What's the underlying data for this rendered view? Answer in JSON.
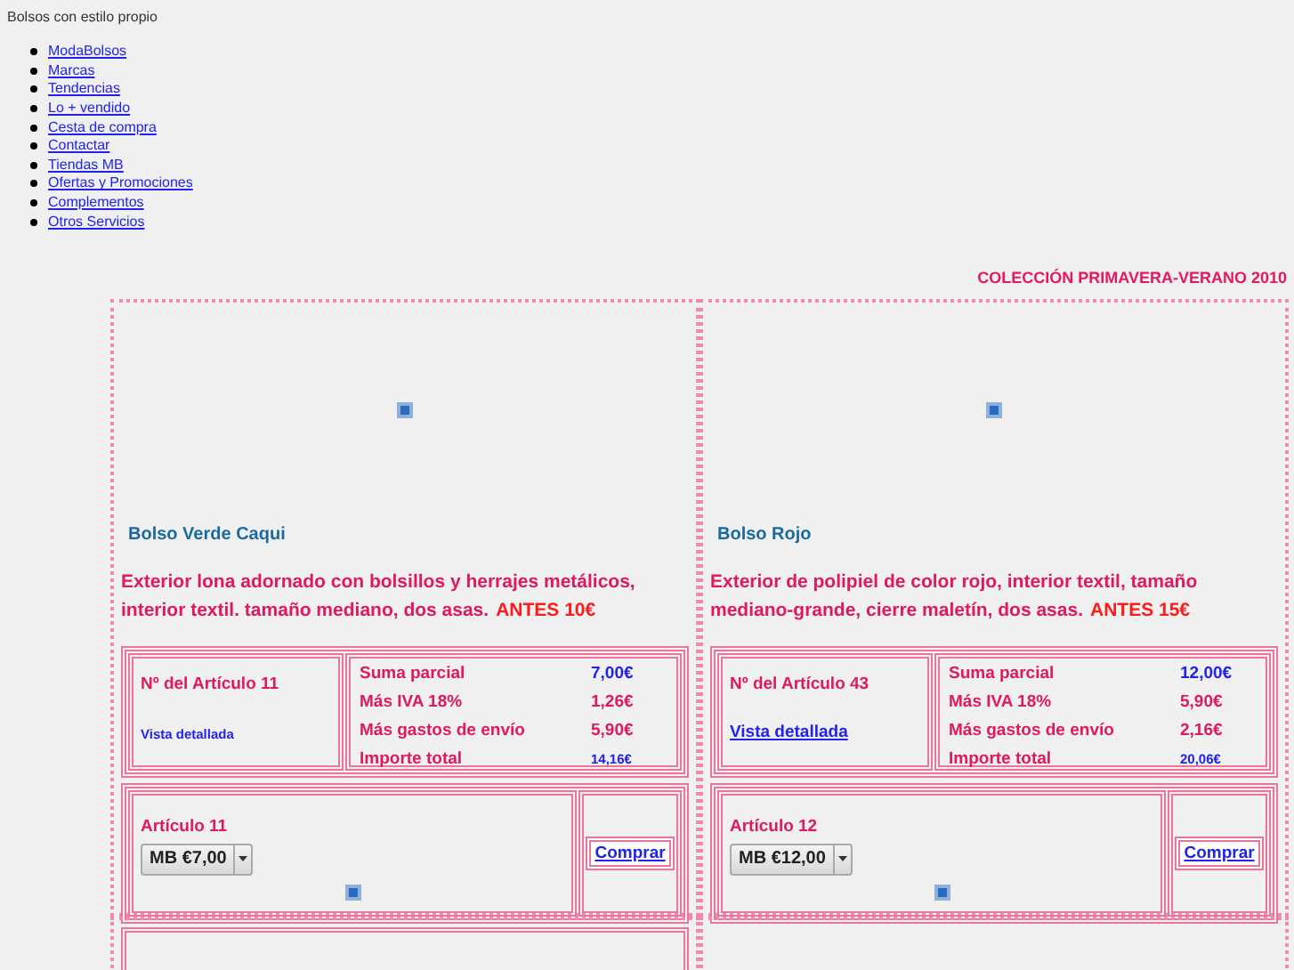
{
  "site_tagline": "Bolsos con estilo propio",
  "nav": [
    "ModaBolsos",
    "Marcas",
    "Tendencias",
    "Lo + vendido",
    "Cesta de compra",
    "Contactar",
    "Tiendas MB",
    "Ofertas y Promociones",
    "Complementos",
    "Otros Servicios"
  ],
  "collection_title": "COLECCIÓN PRIMAVERA-VERANO 2010",
  "products": [
    {
      "name": "Bolso Verde Caqui",
      "description": "Exterior lona adornado con bolsillos y herrajes metálicos, interior textil. tamaño mediano, dos asas.",
      "old_price": "ANTES 10€",
      "article_number": "Nº del Artículo 11",
      "detail_link": {
        "text": "Vista detallada",
        "underlined": false
      },
      "totals": [
        {
          "label": "Suma parcial",
          "value": "7,00€",
          "kind": "base"
        },
        {
          "label": "Más IVA 18%",
          "value": "1,26€",
          "kind": "extra"
        },
        {
          "label": "Más gastos de envío",
          "value": "5,90€",
          "kind": "extra"
        },
        {
          "label": "Importe total",
          "value": "14,16€",
          "kind": "total"
        }
      ],
      "article": "Artículo 11",
      "price_select": "MB €7,00",
      "buy": "Comprar"
    },
    {
      "name": "Bolso Rojo",
      "description": "Exterior de polipiel de color rojo, interior textil, tamaño mediano-grande, cierre maletín, dos asas.",
      "old_price": "ANTES 15€",
      "article_number": "Nº del Artículo 43",
      "detail_link": {
        "text": "Vista detallada",
        "underlined": true
      },
      "totals": [
        {
          "label": "Suma parcial",
          "value": "12,00€",
          "kind": "base"
        },
        {
          "label": "Más IVA 18%",
          "value": "5,90€",
          "kind": "extra"
        },
        {
          "label": "Más gastos de envío",
          "value": "2,16€",
          "kind": "extra"
        },
        {
          "label": "Importe total",
          "value": "20,06€",
          "kind": "total"
        }
      ],
      "article": "Artículo 12",
      "price_select": "MB €12,00",
      "buy": "Comprar"
    }
  ]
}
